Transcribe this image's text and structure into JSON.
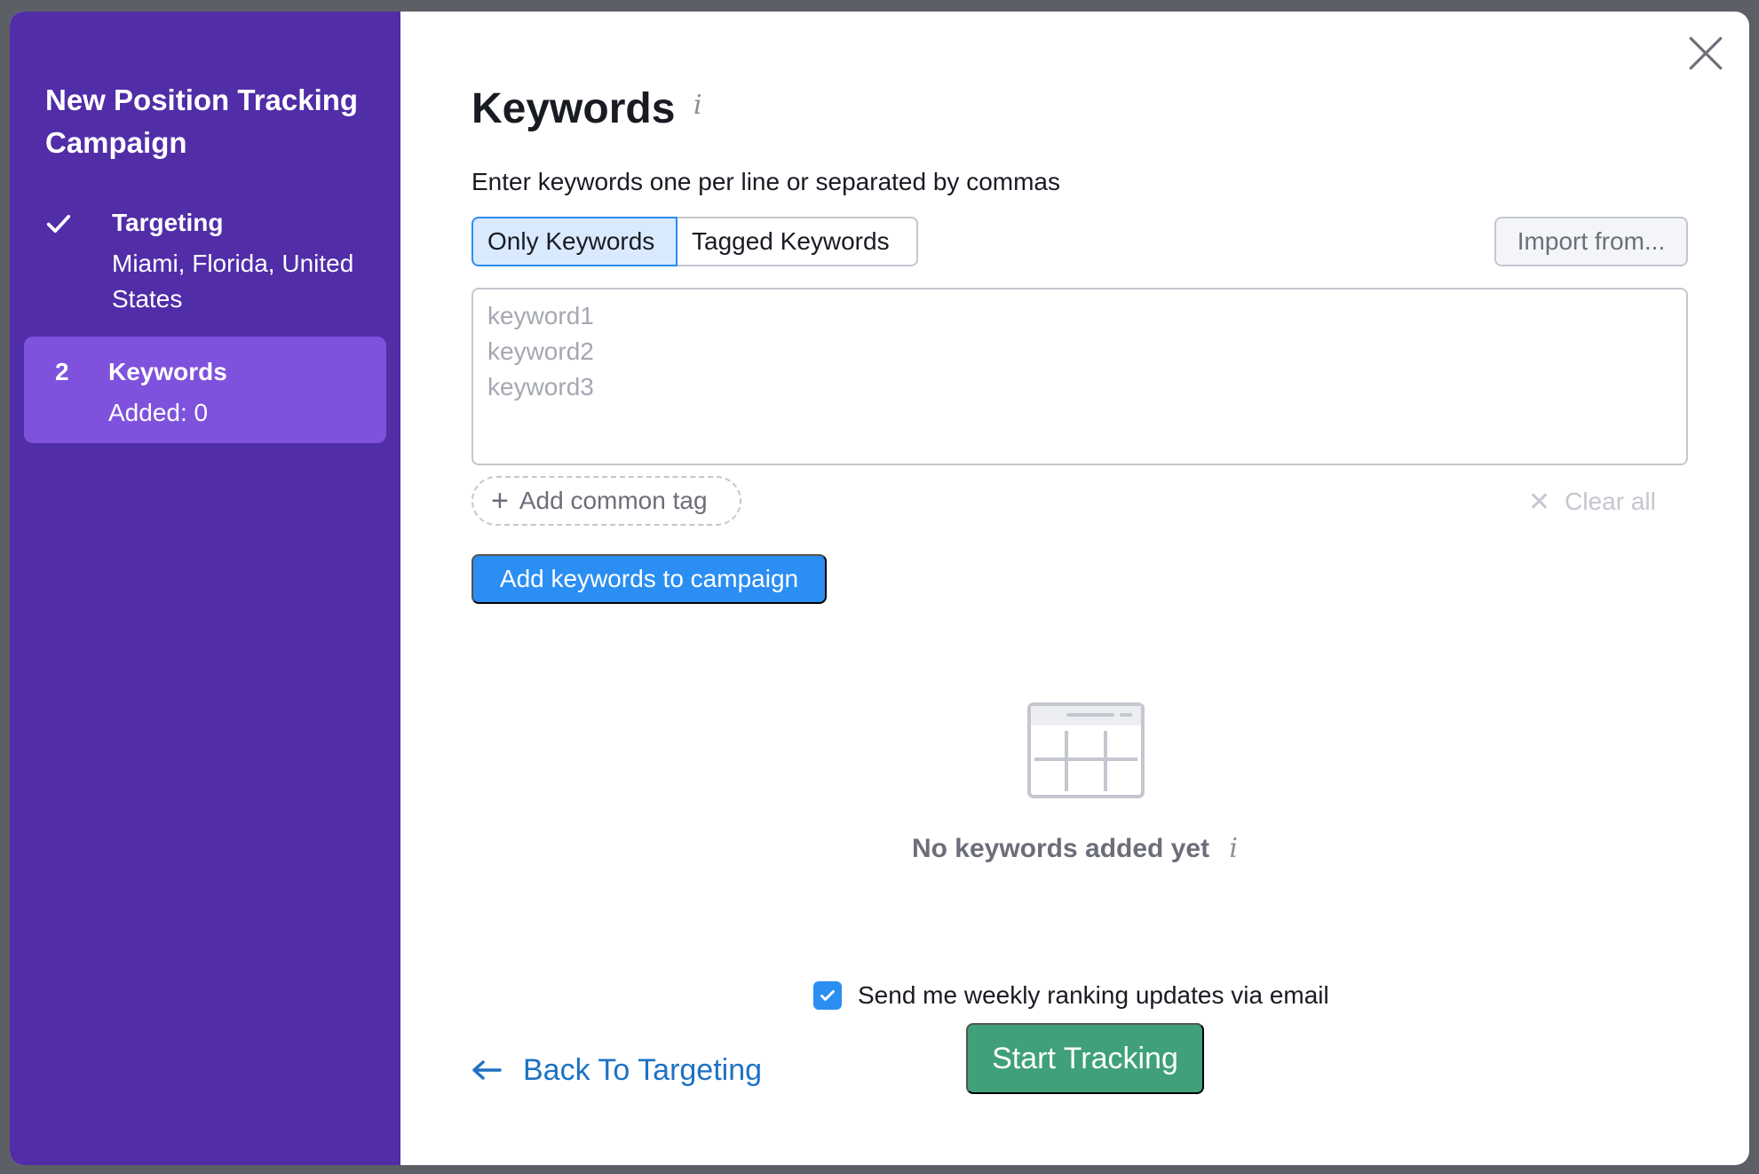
{
  "sidebar": {
    "title": "New Position Tracking Campaign",
    "steps": [
      {
        "marker_icon": "checkmark-icon",
        "name": "Targeting",
        "sub": "Miami, Florida, United States"
      },
      {
        "marker": "2",
        "name": "Keywords",
        "sub": "Added: 0"
      }
    ]
  },
  "main": {
    "title": "Keywords",
    "info_glyph": "i",
    "instructions": "Enter keywords one per line or separated by commas",
    "tabs": [
      "Only Keywords",
      "Tagged Keywords"
    ],
    "import_label": "Import from...",
    "keywords_placeholder": "keyword1\nkeyword2\nkeyword3",
    "add_tag_label": "Add common tag",
    "clear_label": "Clear all",
    "add_button_label": "Add keywords to campaign",
    "empty_state": {
      "icon": "empty-table-icon",
      "text": "No keywords added yet"
    },
    "email_checkbox": {
      "label": "Send me weekly ranking updates via email",
      "checked": true
    },
    "back_label": "Back To Targeting",
    "start_label": "Start Tracking"
  },
  "colors": {
    "sidebar": "#512da8",
    "sidebar_active": "#7e52dc",
    "primary": "#2b8ef2",
    "success": "#3fa07a",
    "link": "#1d72c4",
    "tab_active_bg": "#d9eaff"
  }
}
